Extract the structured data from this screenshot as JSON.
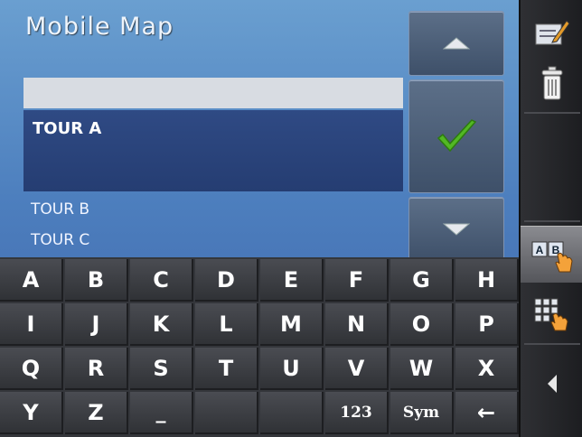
{
  "header": {
    "title": "Mobile  Map"
  },
  "search": {
    "value": ""
  },
  "list": {
    "selected": "TOUR A",
    "items": [
      "TOUR B",
      "TOUR C"
    ]
  },
  "buttons": {
    "up": "up-arrow",
    "confirm": "checkmark",
    "down": "down-arrow"
  },
  "keyboard": {
    "rows": [
      [
        "A",
        "B",
        "C",
        "D",
        "E",
        "F",
        "G",
        "H"
      ],
      [
        "I",
        "J",
        "K",
        "L",
        "M",
        "N",
        "O",
        "P"
      ],
      [
        "Q",
        "R",
        "S",
        "T",
        "U",
        "V",
        "W",
        "X"
      ],
      [
        "Y",
        "Z",
        "_",
        "",
        "",
        "123",
        "Sym",
        "←"
      ]
    ]
  },
  "sidebar": {
    "items": [
      "edit-icon",
      "trash-icon",
      "",
      "keyboard-abc-icon",
      "keypad-icon",
      "back-icon"
    ]
  },
  "colors": {
    "accent": "#2f4a84",
    "check": "#4caf1e"
  }
}
